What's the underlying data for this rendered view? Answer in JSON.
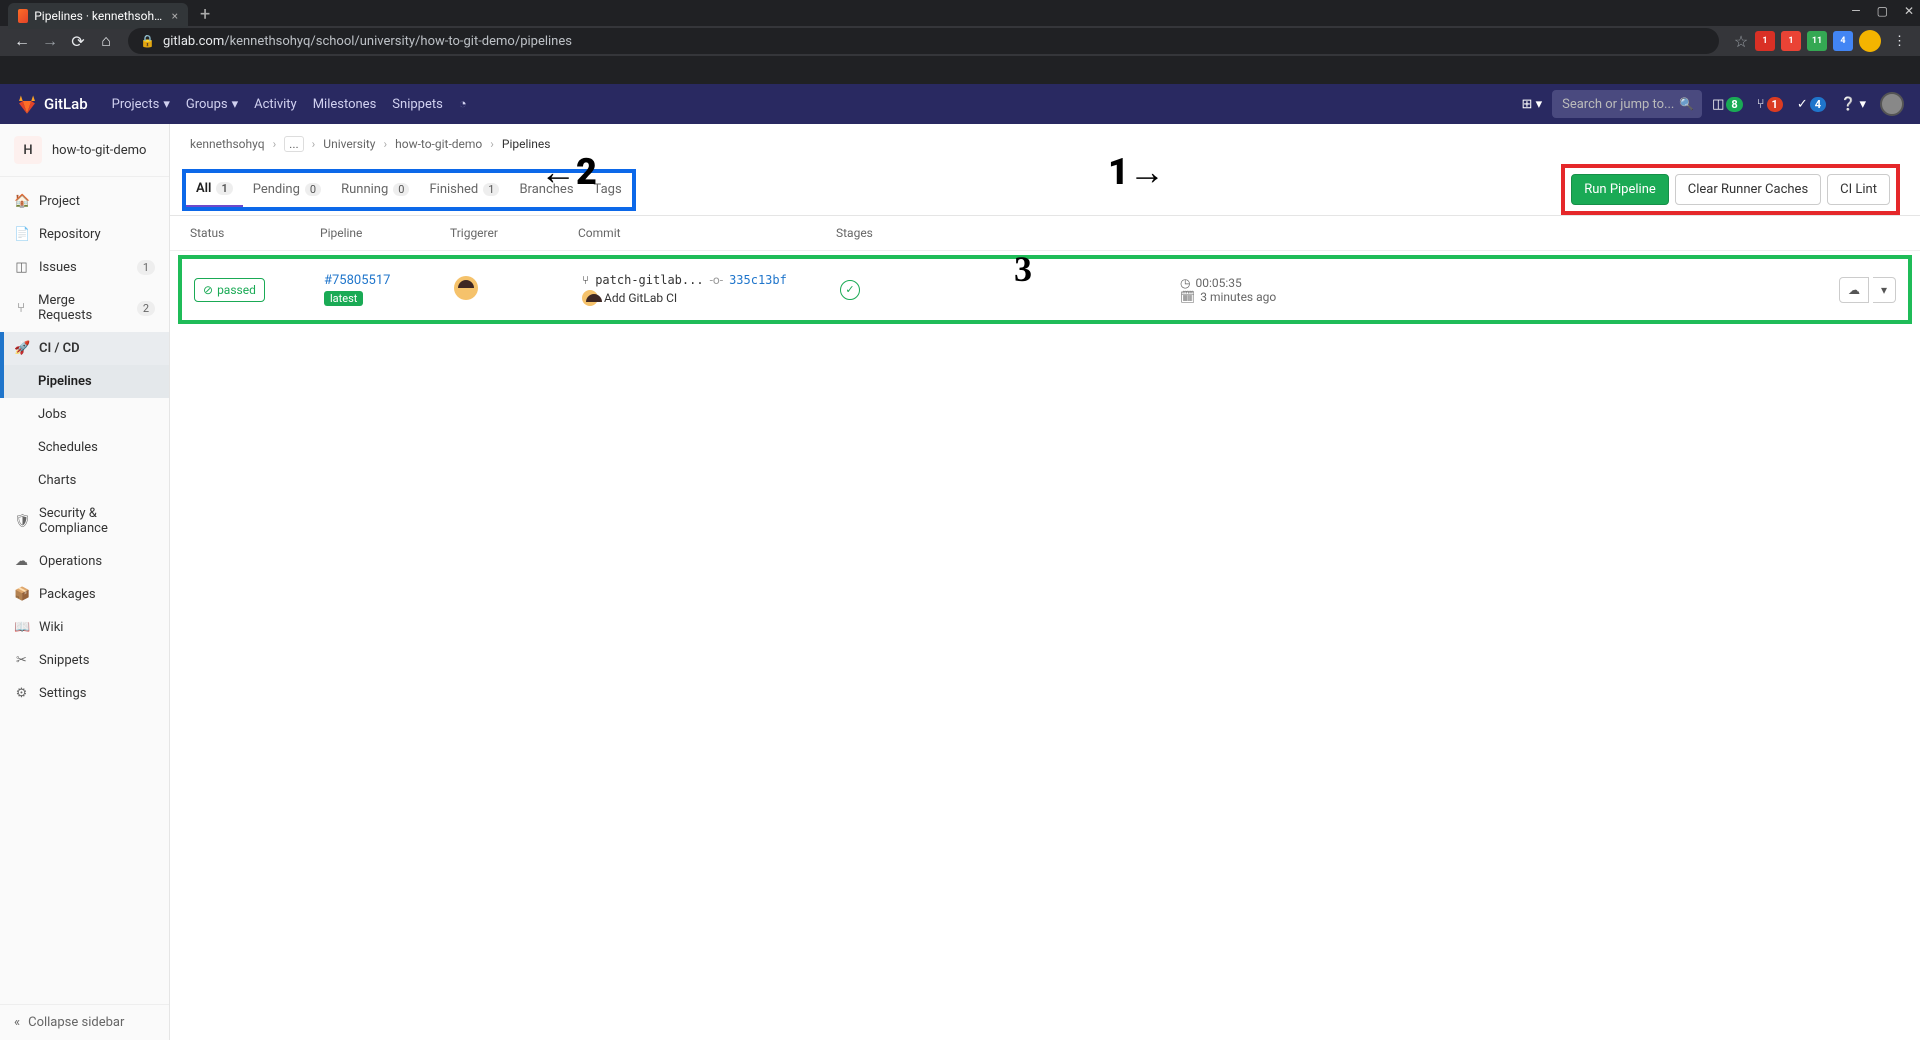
{
  "browser": {
    "tab_title": "Pipelines · kennethsohyq / Schoo",
    "url_host": "gitlab.com",
    "url_path": "/kennethsohyq/school/university/how-to-git-demo/pipelines"
  },
  "topbar": {
    "brand": "GitLab",
    "nav": [
      "Projects",
      "Groups",
      "Activity",
      "Milestones",
      "Snippets"
    ],
    "search_placeholder": "Search or jump to...",
    "counts": {
      "issues": "8",
      "merge": "1",
      "todos": "4"
    }
  },
  "sidebar": {
    "project_letter": "H",
    "project_name": "how-to-git-demo",
    "items": [
      {
        "label": "Project",
        "icon": "🏠"
      },
      {
        "label": "Repository",
        "icon": "📄"
      },
      {
        "label": "Issues",
        "icon": "◫",
        "badge": "1"
      },
      {
        "label": "Merge Requests",
        "icon": "⑂",
        "badge": "2"
      },
      {
        "label": "CI / CD",
        "icon": "🚀",
        "active": true
      },
      {
        "label": "Security & Compliance",
        "icon": "🛡"
      },
      {
        "label": "Operations",
        "icon": "☁"
      },
      {
        "label": "Packages",
        "icon": "📦"
      },
      {
        "label": "Wiki",
        "icon": "📖"
      },
      {
        "label": "Snippets",
        "icon": "✂"
      },
      {
        "label": "Settings",
        "icon": "⚙"
      }
    ],
    "cicd_subitems": [
      "Pipelines",
      "Jobs",
      "Schedules",
      "Charts"
    ],
    "collapse": "Collapse sidebar"
  },
  "breadcrumbs": [
    "kennethsohyq",
    "...",
    "University",
    "how-to-git-demo",
    "Pipelines"
  ],
  "tabs": [
    {
      "label": "All",
      "count": "1",
      "active": true
    },
    {
      "label": "Pending",
      "count": "0"
    },
    {
      "label": "Running",
      "count": "0"
    },
    {
      "label": "Finished",
      "count": "1"
    },
    {
      "label": "Branches"
    },
    {
      "label": "Tags"
    }
  ],
  "buttons": {
    "run": "Run Pipeline",
    "clear": "Clear Runner Caches",
    "lint": "CI Lint"
  },
  "columns": [
    "Status",
    "Pipeline",
    "Triggerer",
    "Commit",
    "Stages"
  ],
  "row": {
    "status": "passed",
    "pipeline_id": "#75805517",
    "pipeline_tag": "latest",
    "branch": "patch-gitlab...",
    "sha": "335c13bf",
    "message": "Add GitLab CI",
    "duration": "00:05:35",
    "finished": "3 minutes ago"
  },
  "annotations": {
    "two": "2",
    "one_arrow": "1",
    "three": "3"
  }
}
